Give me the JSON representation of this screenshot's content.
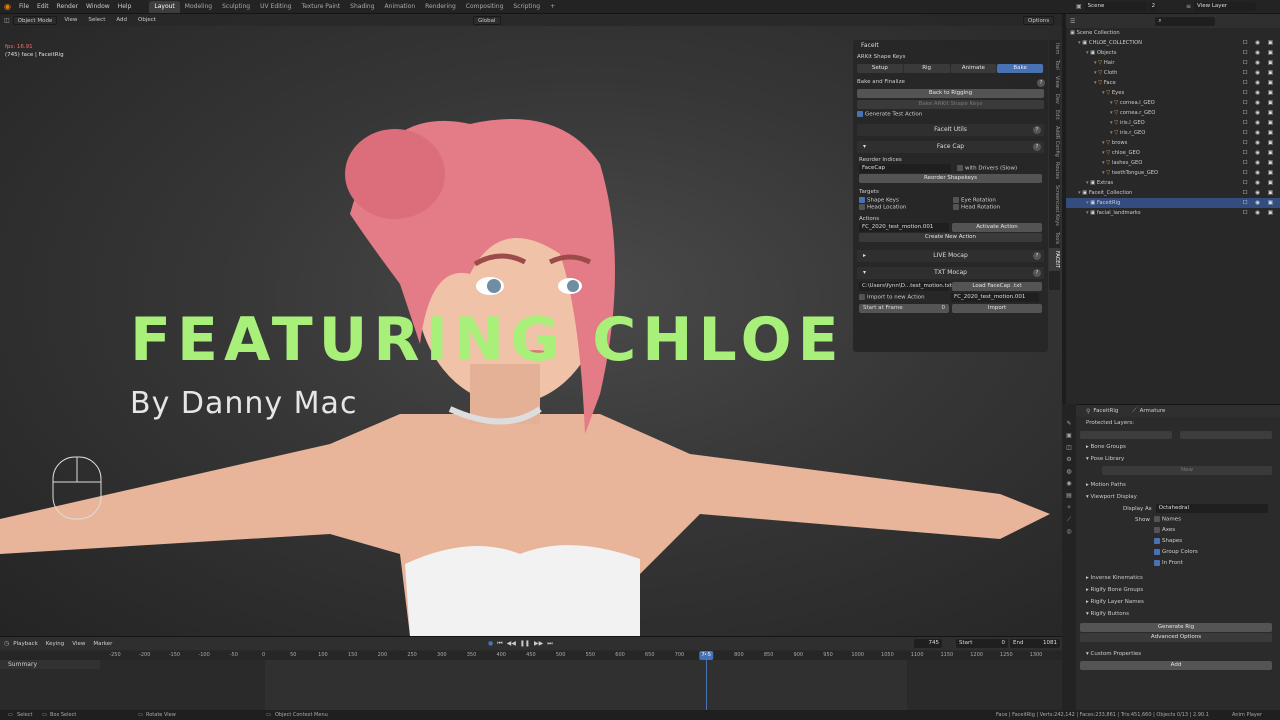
{
  "menu": [
    "File",
    "Edit",
    "Render",
    "Window",
    "Help"
  ],
  "workspaces": [
    "Layout",
    "Modeling",
    "Sculpting",
    "UV Editing",
    "Texture Paint",
    "Shading",
    "Animation",
    "Rendering",
    "Compositing",
    "Scripting",
    "+"
  ],
  "scene": {
    "label": "Scene",
    "count": "2",
    "view_layer": "View Layer"
  },
  "viewport": {
    "mode": "Object Mode",
    "menus": [
      "View",
      "Select",
      "Add",
      "Object"
    ],
    "transform": "Global",
    "options": "Options",
    "fps": "fps: 16.91",
    "info": "(745) face | FaceitRig",
    "title": "FEATURING CHLOE",
    "byline": "By Danny Mac"
  },
  "facelt": {
    "header": "FaceIt",
    "arkit": "ARKit Shape Keys",
    "tabs": [
      "Setup",
      "Rig",
      "Animate",
      "Bake"
    ],
    "bake_title": "Bake and Finalize",
    "back_to_rigging": "Back to Rigging",
    "bake_arkit": "Bake ARKit Shape Keys",
    "generate_test": "Generate Test Action",
    "faceit_utils": "FaceIt Utils",
    "face_cap": "Face Cap",
    "reorder_indices": "Reorder Indices",
    "reorder_value": "FaceCap",
    "with_drivers": "with Drivers (Slow)",
    "reorder_shapekeys": "Reorder Shapekeys",
    "targets": "Targets",
    "shape_keys": "Shape Keys",
    "eye_rotation": "Eye Rotation",
    "head_location": "Head Location",
    "head_rotation": "Head Rotation",
    "actions": "Actions",
    "action_value": "FC_2020_test_motion.001",
    "activate_action": "Activate Action",
    "create_action": "Create New Action",
    "live_mocap": "LIVE Mocap",
    "txt_mocap": "TXT Mocap",
    "file_path": "C:\\Users\\fynn\\D...test_motion.txt",
    "load_facecap": "Load FaceCap .txt",
    "import_new": "Import to new Action",
    "import_action": "FC_2020_test_motion.001",
    "start_at_frame": "Start at Frame",
    "start_value": "0",
    "import": "Import"
  },
  "side_tabs": [
    "Item",
    "Tool",
    "View",
    "Dev",
    "Edit",
    "AddR Config",
    "Routes",
    "Screencast Keys",
    "Tools",
    "FACEIT"
  ],
  "outliner": {
    "title": "Scene Collection",
    "rows": [
      {
        "name": "CHLOE_COLLECTION",
        "indent": 1
      },
      {
        "name": "Objects",
        "indent": 2
      },
      {
        "name": "Hair",
        "indent": 3
      },
      {
        "name": "Cloth",
        "indent": 3
      },
      {
        "name": "Face",
        "indent": 3
      },
      {
        "name": "Eyes",
        "indent": 4
      },
      {
        "name": "cornea.l_GEO",
        "indent": 5
      },
      {
        "name": "cornea.r_GEO",
        "indent": 5
      },
      {
        "name": "iris.l_GEO",
        "indent": 5
      },
      {
        "name": "iris.r_GEO",
        "indent": 5
      },
      {
        "name": "brows",
        "indent": 4
      },
      {
        "name": "chloe_GEO",
        "indent": 4
      },
      {
        "name": "lashes_GEO",
        "indent": 4
      },
      {
        "name": "teethTongue_GEO",
        "indent": 4
      },
      {
        "name": "Extras",
        "indent": 2
      },
      {
        "name": "Faceit_Collection",
        "indent": 1
      },
      {
        "name": "FaceitRig",
        "indent": 2,
        "selected": true
      },
      {
        "name": "facial_landmarks",
        "indent": 2
      }
    ]
  },
  "properties": {
    "object": "FaceitRig",
    "data": "Armature",
    "protected_layers": "Protected Layers:",
    "bone_groups": "Bone Groups",
    "pose_library": "Pose Library",
    "new": "New",
    "motion_paths": "Motion Paths",
    "viewport_display": "Viewport Display",
    "display_as_label": "Display As",
    "display_as": "Octahedral",
    "show": "Show",
    "names": "Names",
    "axes": "Axes",
    "shapes": "Shapes",
    "group_colors": "Group Colors",
    "in_front": "In Front",
    "inverse_kinematics": "Inverse Kinematics",
    "rigify_bone_groups": "Rigify Bone Groups",
    "rigify_layer_names": "Rigify Layer Names",
    "rigify_buttons": "Rigify Buttons",
    "generate_rig": "Generate Rig",
    "advanced_options": "Advanced Options",
    "custom_properties": "Custom Properties",
    "add": "Add"
  },
  "timeline": {
    "menus": [
      "Playback",
      "Keying",
      "View",
      "Marker"
    ],
    "current_frame": "745",
    "start_label": "Start",
    "start": "0",
    "end_label": "End",
    "end": "1081",
    "summary": "Summary",
    "ticks": [
      "-250",
      "-200",
      "-150",
      "-100",
      "-50",
      "0",
      "50",
      "100",
      "150",
      "200",
      "250",
      "300",
      "350",
      "400",
      "450",
      "500",
      "550",
      "600",
      "650",
      "700",
      "745",
      "800",
      "850",
      "900",
      "950",
      "1000",
      "1050",
      "1100",
      "1150",
      "1200",
      "1250",
      "1300"
    ]
  },
  "status": {
    "select": "Select",
    "box_select": "Box Select",
    "rotate_view": "Rotate View",
    "context_menu": "Object Context Menu",
    "stats": "Face | FaceitRig | Verts:242,142 | Faces:233,861 | Tris:451,660 | Objects 0/13 | 2.90.1",
    "anim_player": "Anim Player"
  }
}
